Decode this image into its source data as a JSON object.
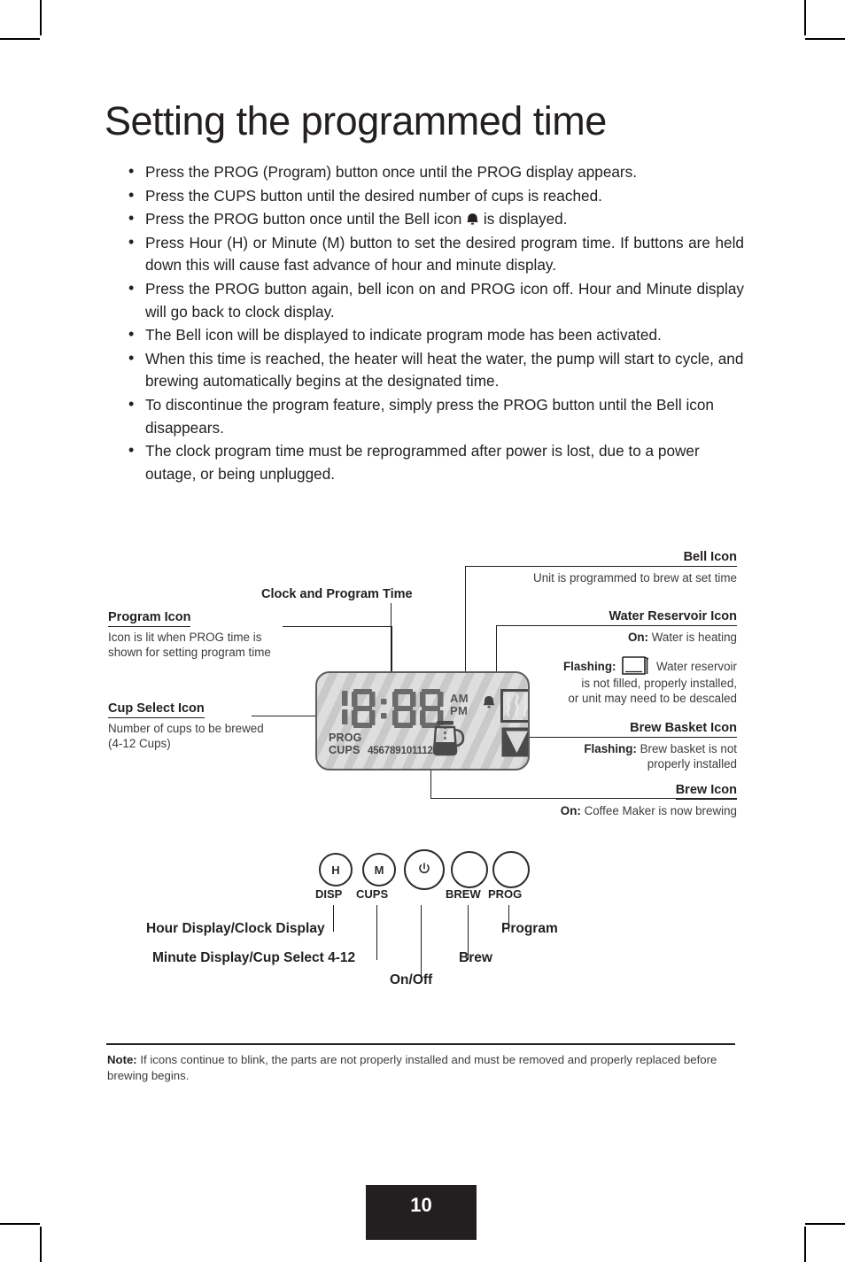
{
  "page": {
    "title": "Setting the programmed time",
    "number": "10"
  },
  "instructions": [
    "Press the PROG (Program) button once until the PROG display appears.",
    "Press the CUPS button until the desired number of cups is reached.",
    "Press the PROG button once until the Bell icon  is displayed.",
    "Press Hour (H) or Minute (M) button to set the desired program time. If buttons are held down this will cause fast advance of hour and minute display.",
    "Press the PROG button again, bell icon on and PROG icon off. Hour and Minute display will go back to clock display.",
    "The Bell icon will be displayed to indicate program mode has been activated.",
    "When this time is reached, the heater will heat the water, the pump will start to cycle, and brewing automatically begins at the designated time.",
    "To discontinue the program feature, simply press the PROG button until the Bell icon disappears.",
    "The clock  program time must be reprogrammed after power is lost, due to a power outage, or being unplugged."
  ],
  "instruction_parts": {
    "bullet3_before": "Press the PROG button once until the Bell icon",
    "bullet3_after": "is displayed."
  },
  "lcd": {
    "time": "18:88",
    "am": "AM",
    "pm": "PM",
    "prog_label": "PROG",
    "cups_label": "CUPS",
    "cups_numbers": "456789101112",
    "icons": [
      "bell-icon",
      "water-reservoir-icon",
      "brew-icon",
      "brew-basket-icon"
    ]
  },
  "callouts": {
    "clock": {
      "heading": "Clock and Program Time",
      "body": ""
    },
    "program_icon": {
      "heading": "Program Icon",
      "body": "Icon is lit when PROG time is shown for setting program time"
    },
    "cup_select": {
      "heading": "Cup Select Icon",
      "body": "Number of cups to be brewed (4-12 Cups)"
    },
    "bell": {
      "heading": "Bell Icon",
      "body": "Unit is programmed to brew at set time"
    },
    "water_reservoir": {
      "heading": "Water Reservoir Icon",
      "on_label": "On:",
      "on_text": " Water is heating",
      "flashing_label": "Flashing:",
      "flashing_text_1": "Water reservoir",
      "flashing_text_2": "is not filled, properly installed,",
      "flashing_text_3": "or unit may need to be descaled"
    },
    "brew_basket": {
      "heading": "Brew Basket Icon",
      "flashing_label": "Flashing:",
      "flashing_text": " Brew basket is not",
      "flashing_text_2": "properly installed"
    },
    "brew": {
      "heading": "Brew Icon",
      "on_label": "On:",
      "on_text": " Coffee Maker is now brewing"
    }
  },
  "controls": {
    "buttons": [
      {
        "glyph": "H",
        "label": "DISP",
        "name": "hour-display-button"
      },
      {
        "glyph": "M",
        "label": "CUPS",
        "name": "minute-cups-button"
      },
      {
        "glyph": "power",
        "label": "",
        "name": "power-button"
      },
      {
        "glyph": "",
        "label": "BREW",
        "name": "brew-button"
      },
      {
        "glyph": "",
        "label": "PROG",
        "name": "prog-button"
      }
    ],
    "descriptions": {
      "hour": "Hour Display/Clock Display",
      "minute": "Minute Display/Cup Select 4-12",
      "onoff": "On/Off",
      "brew": "Brew",
      "program": "Program"
    }
  },
  "note": {
    "label": "Note:",
    "text": " If icons continue to blink, the parts are not properly installed and must be removed and properly replaced before brewing begins."
  },
  "colors": {
    "ink": "#231f20",
    "body_text": "#3c3c3c",
    "lcd_bg": "#c9c9c9",
    "lcd_segment": "#6b6b6b",
    "page_block": "#231f20"
  }
}
